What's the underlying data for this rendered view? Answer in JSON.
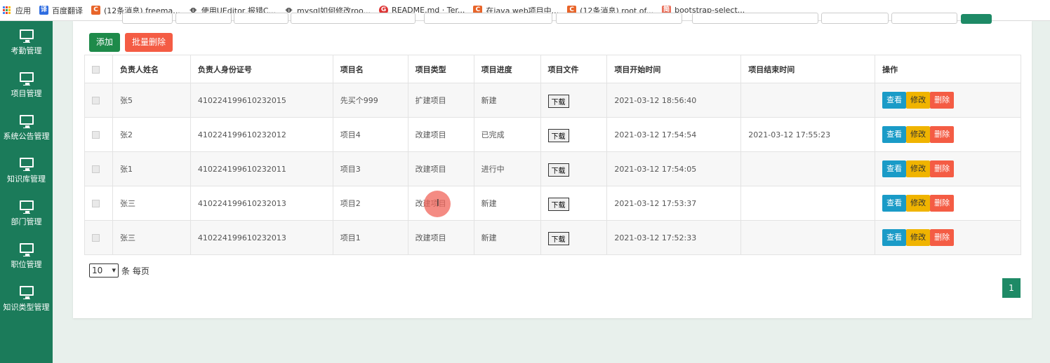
{
  "bookmarks": [
    {
      "icon": "apps-grid-icon",
      "label": "应用"
    },
    {
      "icon": "baidu-translate-icon",
      "label": "百度翻译"
    },
    {
      "icon": "csdn-icon",
      "label": "(12条消息) freema..."
    },
    {
      "icon": "feather-icon",
      "label": "使用UEditor 报错C..."
    },
    {
      "icon": "feather-icon",
      "label": "mysql如何修改roo..."
    },
    {
      "icon": "github-icon",
      "label": "README.md · Ter..."
    },
    {
      "icon": "csdn-icon",
      "label": "在java web项目中..."
    },
    {
      "icon": "csdn-icon",
      "label": "(12条消息) root of..."
    },
    {
      "icon": "jianshu-icon",
      "label": "bootstrap-select..."
    }
  ],
  "sidebar": {
    "items": [
      {
        "label": "考勤管理"
      },
      {
        "label": "项目管理"
      },
      {
        "label": "系统公告管理"
      },
      {
        "label": "知识库管理"
      },
      {
        "label": "部门管理"
      },
      {
        "label": "职位管理"
      },
      {
        "label": "知识类型管理"
      }
    ]
  },
  "toolbar": {
    "add_label": "添加",
    "batch_delete_label": "批量删除"
  },
  "table": {
    "headers": [
      "负责人姓名",
      "负责人身份证号",
      "项目名",
      "项目类型",
      "项目进度",
      "项目文件",
      "项目开始时间",
      "项目结束时间",
      "操作"
    ],
    "download_label": "下载",
    "view_label": "查看",
    "edit_label": "修改",
    "delete_label": "删除",
    "rows": [
      {
        "name": "张5",
        "id_card": "410224199610232015",
        "project": "先买个999",
        "type": "扩建项目",
        "progress": "新建",
        "start": "2021-03-12 18:56:40",
        "end": ""
      },
      {
        "name": "张2",
        "id_card": "410224199610232012",
        "project": "项目4",
        "type": "改建项目",
        "progress": "已完成",
        "start": "2021-03-12 17:54:54",
        "end": "2021-03-12 17:55:23"
      },
      {
        "name": "张1",
        "id_card": "410224199610232011",
        "project": "项目3",
        "type": "改建项目",
        "progress": "进行中",
        "start": "2021-03-12 17:54:05",
        "end": ""
      },
      {
        "name": "张三",
        "id_card": "410224199610232013",
        "project": "项目2",
        "type": "改建项目",
        "progress": "新建",
        "start": "2021-03-12 17:53:37",
        "end": ""
      },
      {
        "name": "张三",
        "id_card": "410224199610232013",
        "project": "项目1",
        "type": "改建项目",
        "progress": "新建",
        "start": "2021-03-12 17:52:33",
        "end": ""
      }
    ]
  },
  "pagination": {
    "page_size": "10",
    "page_size_suffix": "条 每页",
    "current_page": "1"
  },
  "colors": {
    "sidebar": "#1b7b5a",
    "primary_green": "#1e8a66",
    "danger": "#f45c44",
    "info": "#1a9bc7",
    "warning": "#f0b400"
  }
}
